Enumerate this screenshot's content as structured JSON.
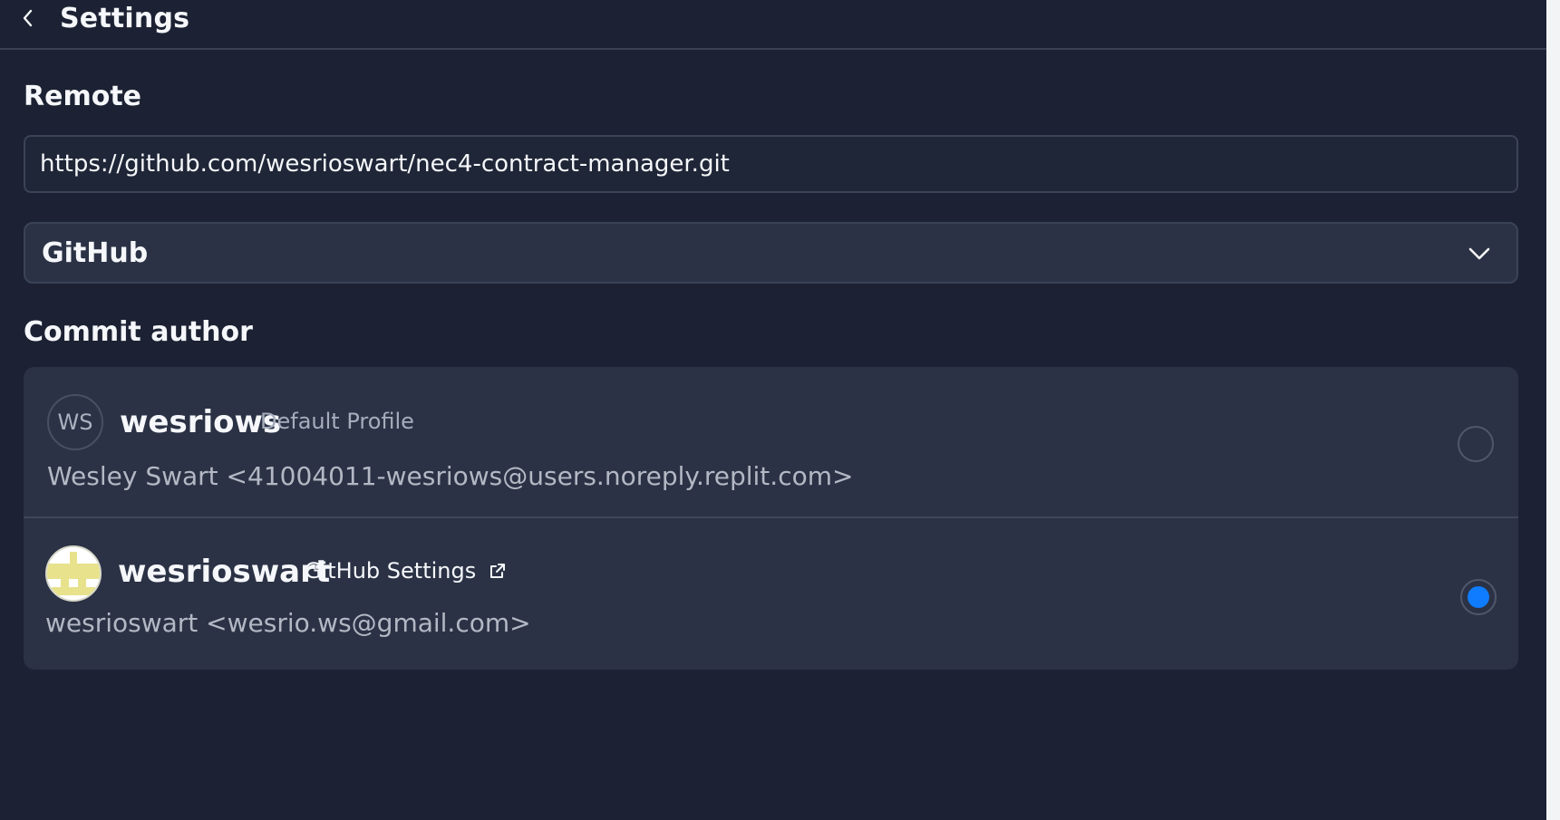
{
  "header": {
    "title": "Settings",
    "back_icon": "chevron-left-icon"
  },
  "remote": {
    "section_title": "Remote",
    "url_value": "https://github.com/wesrioswart/nec4-contract-manager.git",
    "provider_selected": "GitHub",
    "provider_icon": "chevron-down-icon"
  },
  "commit_author": {
    "section_title": "Commit author",
    "profiles": [
      {
        "avatar_initials": "WS",
        "username": "wesriows",
        "label": "Default Profile",
        "email_line": "Wesley Swart <41004011-wesriows@users.noreply.replit.com>",
        "selected": false
      },
      {
        "avatar_icon": "identicon-avatar",
        "username": "wesrioswart",
        "link_label": "GitHub Settings",
        "link_icon": "external-link-icon",
        "email_line": "wesrioswart <wesrio.ws@gmail.com>",
        "selected": true
      }
    ]
  },
  "colors": {
    "background": "#1c2233",
    "surface": "#2b3245",
    "border": "#3b4356",
    "accent": "#0f7cff",
    "text_primary": "#f5f7fa",
    "text_secondary": "#a6adbb",
    "identicon": "#e7e28b"
  }
}
